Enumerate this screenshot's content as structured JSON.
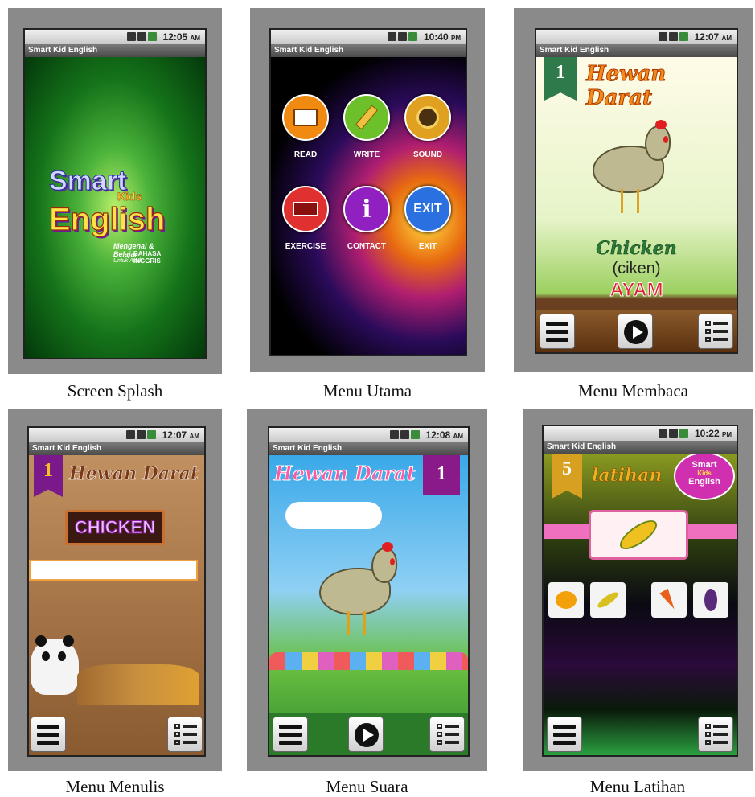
{
  "status_bar": {
    "time_splash": "12:05",
    "ampm_splash": "AM",
    "time_menu": "10:40",
    "ampm_menu": "PM",
    "time_read": "12:07",
    "ampm_read": "AM",
    "time_write": "12:07",
    "ampm_write": "AM",
    "time_sound": "12:08",
    "ampm_sound": "AM",
    "time_exercise": "10:22",
    "ampm_exercise": "PM"
  },
  "app_title": "Smart Kid English",
  "splash": {
    "logo_word1": "Smart",
    "logo_word2": "Kids",
    "logo_word3": "English",
    "sub1": "Mengenal & Belajar",
    "sub2": "BAHASA INGGRIS",
    "sub3": "Untuk Anak"
  },
  "main_menu": {
    "items": [
      {
        "label": "READ",
        "icon": "book-icon",
        "color": "#f08a10"
      },
      {
        "label": "WRITE",
        "icon": "pencil-icon",
        "color": "#6cc02a"
      },
      {
        "label": "SOUND",
        "icon": "speaker-icon",
        "color": "#e0a020"
      },
      {
        "label": "EXERCISE",
        "icon": "book-stack-icon",
        "color": "#e03030"
      },
      {
        "label": "CONTACT",
        "icon": "info-icon",
        "color": "#9020c0"
      },
      {
        "label": "EXIT",
        "icon": "exit-icon",
        "color": "#2a70e0"
      }
    ],
    "info_glyph": "i",
    "exit_glyph": "EXIT"
  },
  "read": {
    "number": "1",
    "title": "Hewan Darat",
    "word": "Chicken",
    "pron": "(ciken)",
    "meaning": "AYAM"
  },
  "write": {
    "number": "1",
    "title": "Hewan Darat",
    "word": "CHICKEN",
    "input_value": ""
  },
  "sound": {
    "number": "1",
    "title": "Hewan Darat"
  },
  "exercise": {
    "number": "5",
    "title": "latihan",
    "logo_word1": "Smart",
    "logo_word2": "Kids",
    "logo_word3": "English",
    "options": [
      {
        "icon": "pumpkin-icon",
        "color": "#f2a10a"
      },
      {
        "icon": "corn-icon",
        "color": "#d8c020"
      },
      {
        "icon": "carrot-icon",
        "color": "#e8601a"
      },
      {
        "icon": "eggplant-icon",
        "color": "#5a2a7a"
      }
    ]
  },
  "captions": {
    "splash": "Screen Splash",
    "menu": "Menu Utama",
    "read": "Menu Membaca",
    "write": "Menu Menulis",
    "sound": "Menu Suara",
    "exercise": "Menu Latihan"
  }
}
